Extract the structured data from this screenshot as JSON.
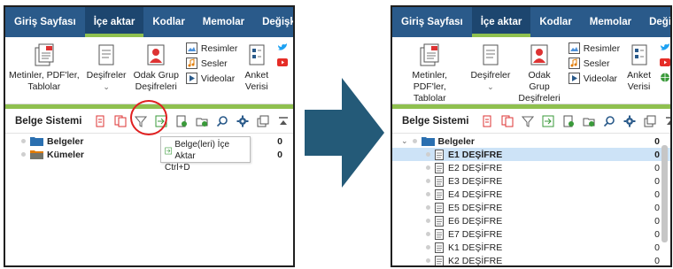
{
  "colors": {
    "menubar": "#2a5a8a",
    "accent": "#8fc04f",
    "arrow": "#245a78",
    "highlight": "#e02020",
    "selection": "#cde3f7"
  },
  "menu": {
    "tabs": [
      "Giriş Sayfası",
      "İçe aktar",
      "Kodlar",
      "Memolar",
      "Değişkenler"
    ]
  },
  "ribbon": {
    "texts": "Metinler, PDF'ler,",
    "texts2": "Tablolar",
    "transcripts": "Deşifreler",
    "focus": "Odak Grup",
    "focus2": "Deşifreleri",
    "images": "Resimler",
    "audio": "Sesler",
    "videos": "Videolar",
    "survey": "Anket",
    "survey2": "Verisi"
  },
  "toolbar": {
    "title": "Belge Sistemi"
  },
  "tooltip": {
    "line1": "Belge(leri) İçe Aktar",
    "line2": "Ctrl+D"
  },
  "left_tree": [
    {
      "label": "Belgeler",
      "count": "0"
    },
    {
      "label": "Kümeler",
      "count": "0"
    }
  ],
  "right_tree": {
    "root": {
      "label": "Belgeler",
      "count": "0"
    },
    "items": [
      {
        "label": "E1 DEŞİFRE",
        "count": "0"
      },
      {
        "label": "E2 DEŞİFRE",
        "count": "0"
      },
      {
        "label": "E3 DEŞİFRE",
        "count": "0"
      },
      {
        "label": "E4 DEŞİFRE",
        "count": "0"
      },
      {
        "label": "E5 DEŞİFRE",
        "count": "0"
      },
      {
        "label": "E6 DEŞİFRE",
        "count": "0"
      },
      {
        "label": "E7 DEŞİFRE",
        "count": "0"
      },
      {
        "label": "K1 DEŞİFRE",
        "count": "0"
      },
      {
        "label": "K2 DEŞİFRE",
        "count": "0"
      }
    ]
  }
}
